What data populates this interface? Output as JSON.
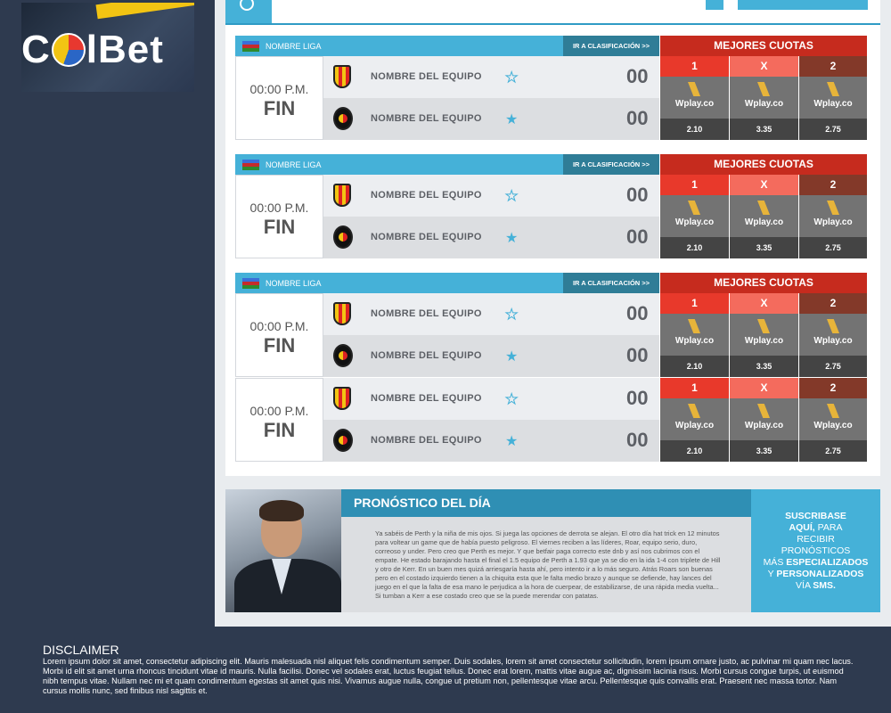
{
  "brand": {
    "logo_text_left": "C",
    "logo_text_right": "lBet"
  },
  "matches_section": {
    "blocks": [
      {
        "league": "NOMBRE LIGA",
        "goto_label": "IR A CLASIFICACIÓN >>",
        "matches": [
          {
            "time": "00:00 P.M.",
            "status": "FIN",
            "home": {
              "name": "NOMBRE DEL EQUIPO",
              "score": "00",
              "favorite": false
            },
            "away": {
              "name": "NOMBRE DEL EQUIPO",
              "score": "00",
              "favorite": true
            },
            "odds_header": "MEJORES CUOTAS",
            "odds": [
              {
                "label": "1",
                "bookmaker": "Wplay.co",
                "value": "2.10"
              },
              {
                "label": "X",
                "bookmaker": "Wplay.co",
                "value": "3.35"
              },
              {
                "label": "2",
                "bookmaker": "Wplay.co",
                "value": "2.75"
              }
            ]
          }
        ]
      },
      {
        "league": "NOMBRE LIGA",
        "goto_label": "IR A CLASIFICACIÓN >>",
        "matches": [
          {
            "time": "00:00 P.M.",
            "status": "FIN",
            "home": {
              "name": "NOMBRE DEL EQUIPO",
              "score": "00",
              "favorite": false
            },
            "away": {
              "name": "NOMBRE DEL EQUIPO",
              "score": "00",
              "favorite": true
            },
            "odds_header": "MEJORES CUOTAS",
            "odds": [
              {
                "label": "1",
                "bookmaker": "Wplay.co",
                "value": "2.10"
              },
              {
                "label": "X",
                "bookmaker": "Wplay.co",
                "value": "3.35"
              },
              {
                "label": "2",
                "bookmaker": "Wplay.co",
                "value": "2.75"
              }
            ]
          }
        ]
      },
      {
        "league": "NOMBRE LIGA",
        "goto_label": "IR A CLASIFICACIÓN >>",
        "matches": [
          {
            "time": "00:00 P.M.",
            "status": "FIN",
            "home": {
              "name": "NOMBRE DEL EQUIPO",
              "score": "00",
              "favorite": false
            },
            "away": {
              "name": "NOMBRE DEL EQUIPO",
              "score": "00",
              "favorite": true
            },
            "odds_header": "MEJORES CUOTAS",
            "odds": [
              {
                "label": "1",
                "bookmaker": "Wplay.co",
                "value": "2.10"
              },
              {
                "label": "X",
                "bookmaker": "Wplay.co",
                "value": "3.35"
              },
              {
                "label": "2",
                "bookmaker": "Wplay.co",
                "value": "2.75"
              }
            ]
          },
          {
            "time": "00:00 P.M.",
            "status": "FIN",
            "home": {
              "name": "NOMBRE DEL EQUIPO",
              "score": "00",
              "favorite": false
            },
            "away": {
              "name": "NOMBRE DEL EQUIPO",
              "score": "00",
              "favorite": true
            },
            "odds_header": "",
            "odds": [
              {
                "label": "1",
                "bookmaker": "Wplay.co",
                "value": "2.10"
              },
              {
                "label": "X",
                "bookmaker": "Wplay.co",
                "value": "3.35"
              },
              {
                "label": "2",
                "bookmaker": "Wplay.co",
                "value": "2.75"
              }
            ]
          }
        ]
      }
    ]
  },
  "pronostico": {
    "title": "PRONÓSTICO DEL DÍA",
    "body": "Ya sabéis de Perth y la niña de mis ojos. Si juega las opciones de derrota se alejan. El otro día hat trick en 12 minutos para voltear un game que de había puesto peligroso. El viernes reciben a las líderes, Roar, equipo serio, duro, correoso y under. Pero creo que Perth es mejor. Y que betfair paga correcto este dnb y así nos cubrimos con el empate. He estado barajando hasta el final el 1.5 equipo de Perth a 1.93 que ya se dio en la ida 1-4 con triplete de Hill y otro de Kerr. En un buen mes quizá arriesgaría hasta ahí, pero intento ir a lo más seguro. Atrás Roars son buenas pero en el costado izquierdo tienen a la chiquita esta que le falta medio brazo y aunque se defiende, hay lances del juego en el que la falta de esa mano le perjudica a la hora de cuerpear, de estabilizarse, de una rápida media vuelta... Si tumban a Kerr a ese costado creo que se la puede merendar con patatas."
  },
  "subscribe": {
    "l1": "SUSCRIBASE",
    "l2": "AQUÍ,",
    "l2b": " PARA",
    "l3": "RECIBIR",
    "l4": "PRONÓSTICOS",
    "l5a": "MÁS ",
    "l5b": "ESPECIALIZADOS",
    "l6a": "Y ",
    "l6b": "PERSONALIZADOS",
    "l7a": "VÍA ",
    "l7b": "SMS."
  },
  "footer": {
    "title": "DISCLAIMER",
    "text": "Lorem ipsum dolor sit amet, consectetur adipiscing elit. Mauris malesuada nisl aliquet felis condimentum semper. Duis sodales, lorem sit amet consectetur sollicitudin, lorem ipsum ornare justo, ac pulvinar mi quam nec lacus. Morbi id elit sit amet urna rhoncus tincidunt vitae id mauris. Nulla facilisi. Donec vel sodales erat, luctus feugiat tellus. Donec erat lorem, mattis vitae augue ac, dignissim lacinia risus. Morbi cursus congue turpis, ut euismod nibh tempus vitae. Nullam nec mi et quam condimentum egestas sit amet quis nisi. Vivamus augue nulla, congue ut pretium non, pellentesque vitae arcu. Pellentesque quis convallis erat. Praesent nec massa tortor. Nam cursus mollis nunc, sed finibus nisl sagittis et."
  },
  "colors": {
    "accent": "#45b1d8",
    "dark": "#2e3a4f",
    "odds_red": "#c62b1e"
  }
}
